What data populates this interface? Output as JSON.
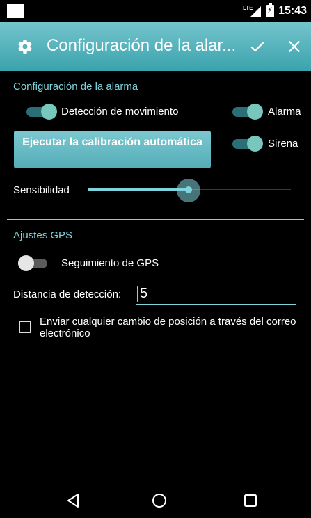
{
  "status_bar": {
    "network": "LTE",
    "time": "15:43"
  },
  "action_bar": {
    "title": "Configuración de la alar...",
    "icons": {
      "settings": "gear-icon",
      "confirm": "check-icon",
      "close": "close-icon"
    }
  },
  "alarm_section": {
    "header": "Configuración de la alarma",
    "motion_detection": {
      "label": "Detección de movimiento",
      "on": true
    },
    "alarm": {
      "label": "Alarma",
      "on": true
    },
    "siren": {
      "label": "Sirena",
      "on": true
    },
    "calibration_button": "Ejecutar la calibración automática",
    "sensitivity": {
      "label": "Sensibilidad",
      "value_fraction": 0.5
    }
  },
  "gps_section": {
    "header": "Ajustes GPS",
    "gps_tracking": {
      "label": "Seguimiento de GPS",
      "on": false
    },
    "detection_distance": {
      "label": "Distancia de detección:",
      "value": "5"
    },
    "email_checkbox": {
      "label": "Enviar cualquier cambio de posición a través del correo electrónico",
      "checked": false
    }
  },
  "nav_bar": {
    "icons": [
      "back-icon",
      "home-icon",
      "recent-apps-icon"
    ]
  },
  "colors": {
    "accent": "#7fd3dc",
    "action_bar": "#4fb0ba",
    "background": "#000000"
  }
}
